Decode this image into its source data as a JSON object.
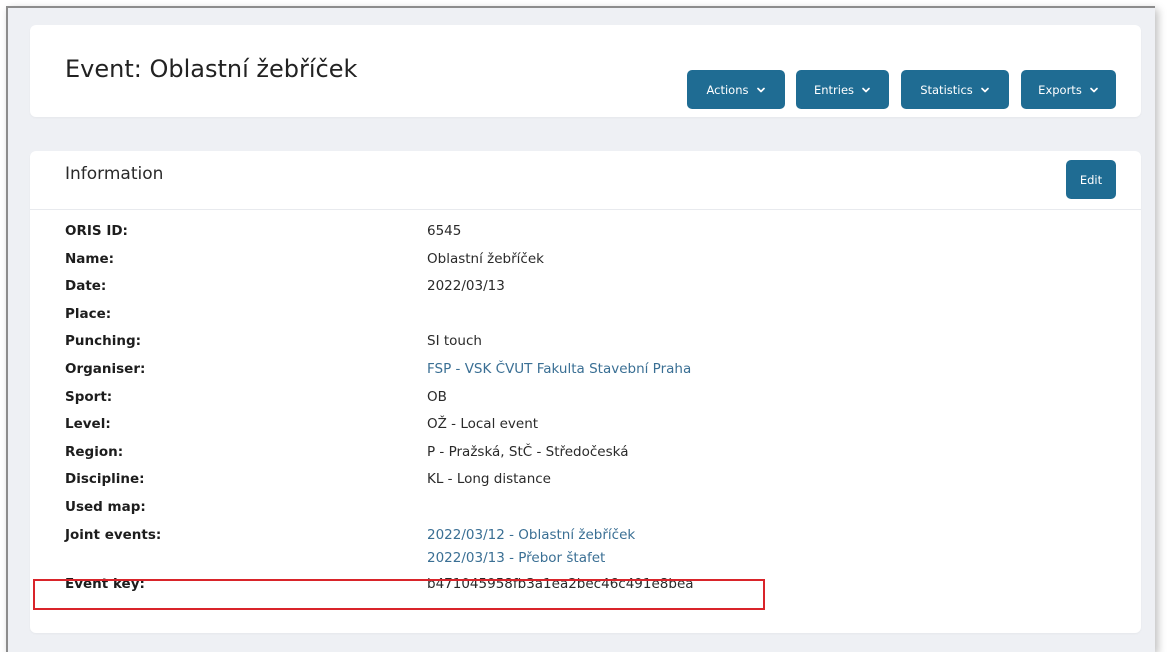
{
  "header": {
    "title": "Event: Oblastní žebříček",
    "buttons": [
      {
        "label": "Actions"
      },
      {
        "label": "Entries"
      },
      {
        "label": "Statistics"
      },
      {
        "label": "Exports"
      }
    ]
  },
  "info": {
    "title": "Information",
    "edit_label": "Edit",
    "rows": [
      {
        "label": "ORIS ID:",
        "value": "6545"
      },
      {
        "label": "Name:",
        "value": "Oblastní žebříček"
      },
      {
        "label": "Date:",
        "value": "2022/03/13"
      },
      {
        "label": "Place:",
        "value": ""
      },
      {
        "label": "Punching:",
        "value": "SI touch"
      },
      {
        "label": "Organiser:",
        "value": "FSP - VSK ČVUT Fakulta Stavební Praha"
      },
      {
        "label": "Sport:",
        "value": "OB"
      },
      {
        "label": "Level:",
        "value": "OŽ - Local event"
      },
      {
        "label": "Region:",
        "value": "P - Pražská, StČ - Středočeská"
      },
      {
        "label": "Discipline:",
        "value": "KL - Long distance"
      },
      {
        "label": "Used map:",
        "value": ""
      },
      {
        "label": "Joint events:",
        "links": [
          "2022/03/12 - Oblastní žebříček",
          "2022/03/13 - Přebor štafet"
        ]
      },
      {
        "label": "Event key:",
        "value": "b471045958fb3a1ea2bec46c491e8bea"
      }
    ]
  },
  "colors": {
    "accent": "#1f6c93",
    "link": "#3a6f94",
    "highlight": "#d9242a",
    "background": "#eef0f4"
  }
}
